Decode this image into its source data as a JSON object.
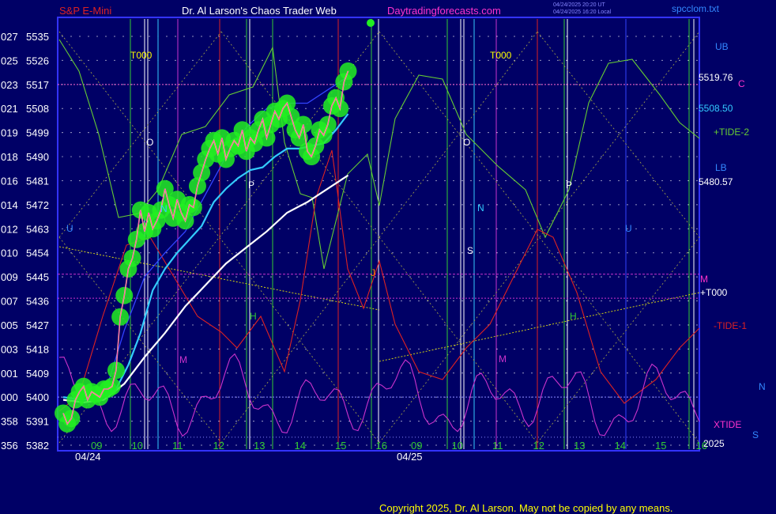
{
  "header": {
    "symbol": "S&P E-Mini",
    "title": "Dr. Al Larson's Chaos Trader Web",
    "website": "Daytradingforecasts.com",
    "update_line1": "04/24/2025 20:20 UT",
    "update_line2": "04/24/2025 16:20 Local",
    "file": "spcclom.txt"
  },
  "footer": {
    "copyright": "Copyright 2025, Dr. Al Larson. May not be copied by any means."
  },
  "colors": {
    "background": "#000066",
    "plot_frame": "#3333ff",
    "grid_dots": "#ffffff",
    "price_glow": "#22ee22",
    "price_line": "#ffff66",
    "price_core": "#ff33cc",
    "cyan_average": "#33ccff",
    "white_average": "#ffffff",
    "blue_average": "#3344ff",
    "tide2": "#66cc33",
    "tide1": "#dd2222",
    "xtide": "#cc33cc",
    "T000": "#ffff00"
  },
  "chart_data": {
    "type": "line",
    "y_axis": {
      "labels": [
        [
          "027",
          "5535"
        ],
        [
          "025",
          "5526"
        ],
        [
          "023",
          "5517"
        ],
        [
          "021",
          "5508"
        ],
        [
          "019",
          "5499"
        ],
        [
          "018",
          "5490"
        ],
        [
          "016",
          "5481"
        ],
        [
          "014",
          "5472"
        ],
        [
          "012",
          "5463"
        ],
        [
          "010",
          "5454"
        ],
        [
          "009",
          "5445"
        ],
        [
          "007",
          "5436"
        ],
        [
          "005",
          "5427"
        ],
        [
          "003",
          "5418"
        ],
        [
          "001",
          "5409"
        ],
        [
          "000",
          "5400"
        ],
        [
          "358",
          "5391"
        ],
        [
          "356",
          "5382"
        ]
      ],
      "ylim": [
        5382,
        5535
      ]
    },
    "x_axis": {
      "hour_ticks": [
        "09",
        "10",
        "11",
        "12",
        "13",
        "14",
        "15",
        "16",
        "09",
        "10",
        "11",
        "12",
        "13",
        "14",
        "15",
        "16"
      ],
      "dates": [
        "04/24",
        "04/25"
      ]
    },
    "levels": [
      {
        "name": "UB",
        "value": 5519.76,
        "label": "5519.76",
        "tag": "C"
      },
      {
        "name": "cyan",
        "value": 5508.5,
        "label": "5508.50"
      },
      {
        "name": "LB",
        "value": 5480.57,
        "label": "5480.57"
      },
      {
        "name": "M",
        "value": 5446,
        "label": "M"
      },
      {
        "name": "pink_dotted",
        "value": 5517
      },
      {
        "name": "purple_dotted",
        "value": 5437
      }
    ],
    "right_labels": {
      "ub": "UB",
      "c": "C",
      "tide2": "+TIDE-2",
      "lb": "LB",
      "m": "M",
      "t000": "+T000",
      "tide1": "-TIDE-1",
      "xtide": "XTIDE",
      "year": "2025",
      "n": "N",
      "s": "S"
    },
    "series": [
      {
        "name": "S&P E-Mini",
        "x": [
          0,
          0.1,
          0.2,
          0.3,
          0.4,
          0.5,
          0.6,
          0.7,
          0.8,
          0.9,
          1.0,
          1.1,
          1.2,
          1.3,
          1.4,
          1.5,
          1.6,
          1.7,
          1.8,
          1.9,
          2.0,
          2.1,
          2.2,
          2.3,
          2.4,
          2.5,
          2.6,
          2.7,
          2.8,
          2.9,
          3.0,
          3.1,
          3.2,
          3.3,
          3.4,
          3.5,
          3.6,
          3.7,
          3.8,
          3.9,
          4.0,
          4.1,
          4.2,
          4.3,
          4.4,
          4.5,
          4.6,
          4.7,
          4.8,
          4.9,
          5.0,
          5.1,
          5.2,
          5.3,
          5.4,
          5.5,
          5.6,
          5.7,
          5.8,
          5.9,
          6.0,
          6.1,
          6.2,
          6.3,
          6.4,
          6.5,
          6.6,
          6.7,
          6.8,
          6.9,
          7.0
        ],
        "y": [
          5394,
          5390,
          5392,
          5399,
          5402,
          5404,
          5399,
          5402,
          5401,
          5400,
          5403,
          5403,
          5404,
          5410,
          5430,
          5438,
          5448,
          5452,
          5459,
          5470,
          5462,
          5469,
          5463,
          5466,
          5470,
          5478,
          5472,
          5467,
          5474,
          5469,
          5466,
          5472,
          5471,
          5479,
          5484,
          5489,
          5493,
          5496,
          5491,
          5497,
          5489,
          5493,
          5496,
          5494,
          5500,
          5492,
          5497,
          5495,
          5500,
          5504,
          5497,
          5502,
          5507,
          5504,
          5508,
          5510,
          5505,
          5500,
          5497,
          5502,
          5492,
          5490,
          5494,
          5500,
          5498,
          5502,
          5509,
          5512,
          5508,
          5518,
          5522
        ]
      },
      {
        "name": "cyan average",
        "x": [
          0,
          0.5,
          1.0,
          1.3,
          1.6,
          1.9,
          2.2,
          2.5,
          2.8,
          3.1,
          3.4,
          3.7,
          4.0,
          4.3,
          4.6,
          4.9,
          5.2,
          5.5,
          5.8,
          6.1,
          6.4,
          6.7,
          7.0
        ],
        "y": [
          5400,
          5399,
          5400,
          5403,
          5412,
          5424,
          5440,
          5448,
          5454,
          5459,
          5464,
          5473,
          5478,
          5482,
          5485,
          5486,
          5490,
          5493,
          5493,
          5494,
          5495,
          5500,
          5506
        ]
      },
      {
        "name": "white average",
        "x": [
          0,
          0.5,
          1.0,
          1.5,
          2.0,
          2.5,
          3.0,
          3.5,
          4.0,
          4.5,
          5.0,
          5.5,
          6.0,
          6.5,
          7.0
        ],
        "y": [
          5399,
          5398,
          5399,
          5405,
          5415,
          5424,
          5434,
          5442,
          5450,
          5456,
          5462,
          5469,
          5473,
          5478,
          5483
        ]
      },
      {
        "name": "blue average",
        "x": [
          0,
          0.5,
          1.0,
          1.5,
          2.0,
          2.5,
          3.0,
          3.5,
          4.0,
          4.5,
          5.0,
          5.5,
          6.0,
          6.5,
          7.0
        ],
        "y": [
          5400,
          5398,
          5400,
          5425,
          5445,
          5454,
          5462,
          5476,
          5490,
          5501,
          5508,
          5510,
          5510,
          5515,
          5520
        ]
      }
    ]
  }
}
